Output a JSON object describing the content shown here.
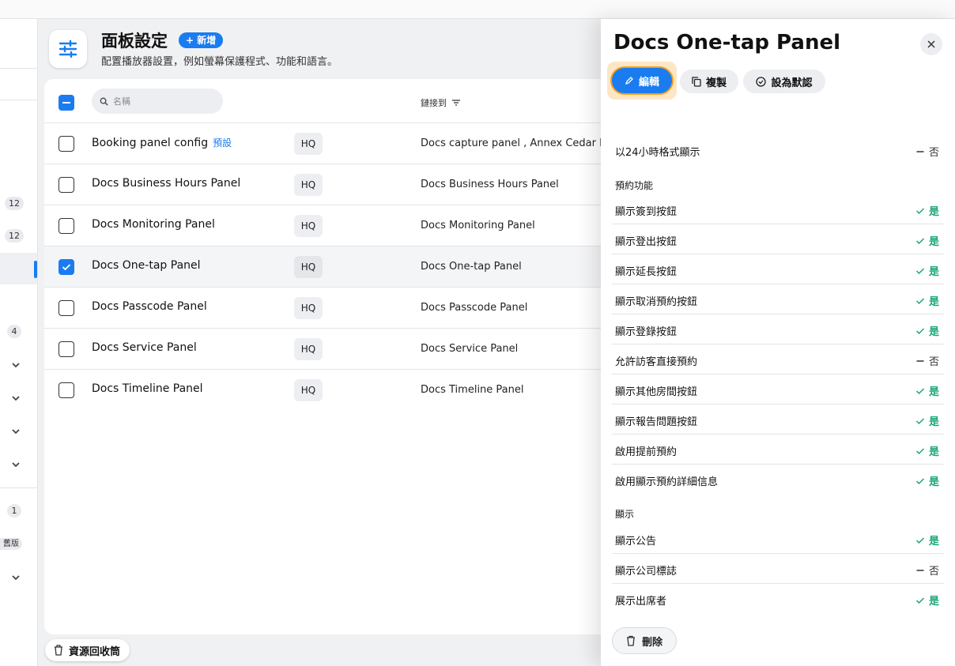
{
  "nav": {
    "badges": [
      "12",
      "12",
      "4",
      "1"
    ],
    "legacy_label": "舊版"
  },
  "header": {
    "title": "面板設定",
    "add_label": "+ 新增",
    "subtitle": "配置播放器設置，例如螢幕保護程式、功能和語言。"
  },
  "table": {
    "search_placeholder": "名稱",
    "col_linked": "鏈接到",
    "rows": [
      {
        "name": "Booking panel config",
        "default": "預設",
        "tag": "HQ",
        "linked": "Docs capture panel , Annex Cedar Roo",
        "checked": false
      },
      {
        "name": "Docs Business Hours Panel",
        "tag": "HQ",
        "linked": "Docs Business Hours Panel",
        "checked": false
      },
      {
        "name": "Docs Monitoring Panel",
        "tag": "HQ",
        "linked": "Docs Monitoring Panel",
        "checked": false
      },
      {
        "name": "Docs One-tap Panel",
        "tag": "HQ",
        "linked": "Docs One-tap Panel",
        "checked": true
      },
      {
        "name": "Docs Passcode Panel",
        "tag": "HQ",
        "linked": "Docs Passcode Panel",
        "checked": false
      },
      {
        "name": "Docs Service Panel",
        "tag": "HQ",
        "linked": "Docs Service Panel",
        "checked": false
      },
      {
        "name": "Docs Timeline Panel",
        "tag": "HQ",
        "linked": "Docs Timeline Panel",
        "checked": false
      }
    ]
  },
  "trash_label": "資源回收筒",
  "panel": {
    "title": "Docs One-tap Panel",
    "edit_label": "編輯",
    "copy_label": "複製",
    "default_label": "設為默認",
    "delete_label": "刪除",
    "yes": "是",
    "no": "否",
    "rows": [
      {
        "label": "以24小時格式顯示",
        "value": "否"
      },
      {
        "label": "顯示簽到按鈕",
        "value": "是"
      },
      {
        "label": "顯示登出按鈕",
        "value": "是"
      },
      {
        "label": "顯示延長按鈕",
        "value": "是"
      },
      {
        "label": "顯示取消預約按鈕",
        "value": "是"
      },
      {
        "label": "顯示登錄按鈕",
        "value": "是"
      },
      {
        "label": "允許訪客直接預約",
        "value": "否"
      },
      {
        "label": "顯示其他房間按鈕",
        "value": "是"
      },
      {
        "label": "顯示報告問題按鈕",
        "value": "是"
      },
      {
        "label": "啟用提前預約",
        "value": "是"
      },
      {
        "label": "啟用顯示預約詳細信息",
        "value": "是"
      },
      {
        "label": "顯示公告",
        "value": "是"
      },
      {
        "label": "顯示公司標誌",
        "value": "否"
      },
      {
        "label": "展示出席者",
        "value": "是"
      }
    ],
    "sections": {
      "booking": "預約功能",
      "display": "顯示"
    }
  },
  "colors": {
    "accent": "#1a7cf0",
    "yes": "#17a673",
    "highlight": "#f0a020"
  }
}
